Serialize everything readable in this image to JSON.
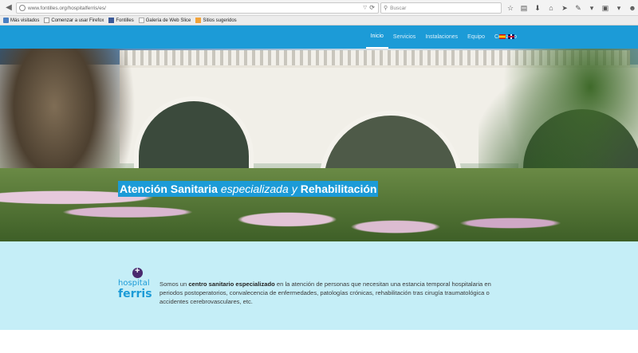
{
  "browser": {
    "url": "www.fontilles.org/hospitalferris/es/",
    "search_placeholder": "Buscar"
  },
  "bookmarks": [
    {
      "label": "Más visitados",
      "icon": "most-visited-icon"
    },
    {
      "label": "Comenzar a usar Firefox",
      "icon": "page-icon"
    },
    {
      "label": "Fontilles",
      "icon": "facebook-icon"
    },
    {
      "label": "Galería de Web Slice",
      "icon": "page-icon"
    },
    {
      "label": "Sitios sugeridos",
      "icon": "suggested-icon"
    }
  ],
  "site": {
    "nav": [
      {
        "label": "Inicio",
        "active": true
      },
      {
        "label": "Servicios",
        "active": false
      },
      {
        "label": "Instalaciones",
        "active": false
      },
      {
        "label": "Equipo",
        "active": false
      },
      {
        "label": "Contacto",
        "active": false
      }
    ],
    "hero": {
      "part1": "Atención Sanitaria",
      "part2": "especializada",
      "part3": "y",
      "part4": "Rehabilitación"
    },
    "logo": {
      "line1": "hospital",
      "line2": "ferris"
    },
    "intro": {
      "lead": "Somos un",
      "bold": "centro sanitario especializado",
      "rest": "en la atención de personas que necesitan una estancia temporal hospitalaria en periodos postoperatorios, convalecencia de enfermedades, patologías crónicas, rehabilitación tras cirugía traumatológica o accidentes cerebrovasculares, etc."
    }
  },
  "colors": {
    "brand": "#1c9bd7",
    "intro_bg": "#c5eef7"
  }
}
